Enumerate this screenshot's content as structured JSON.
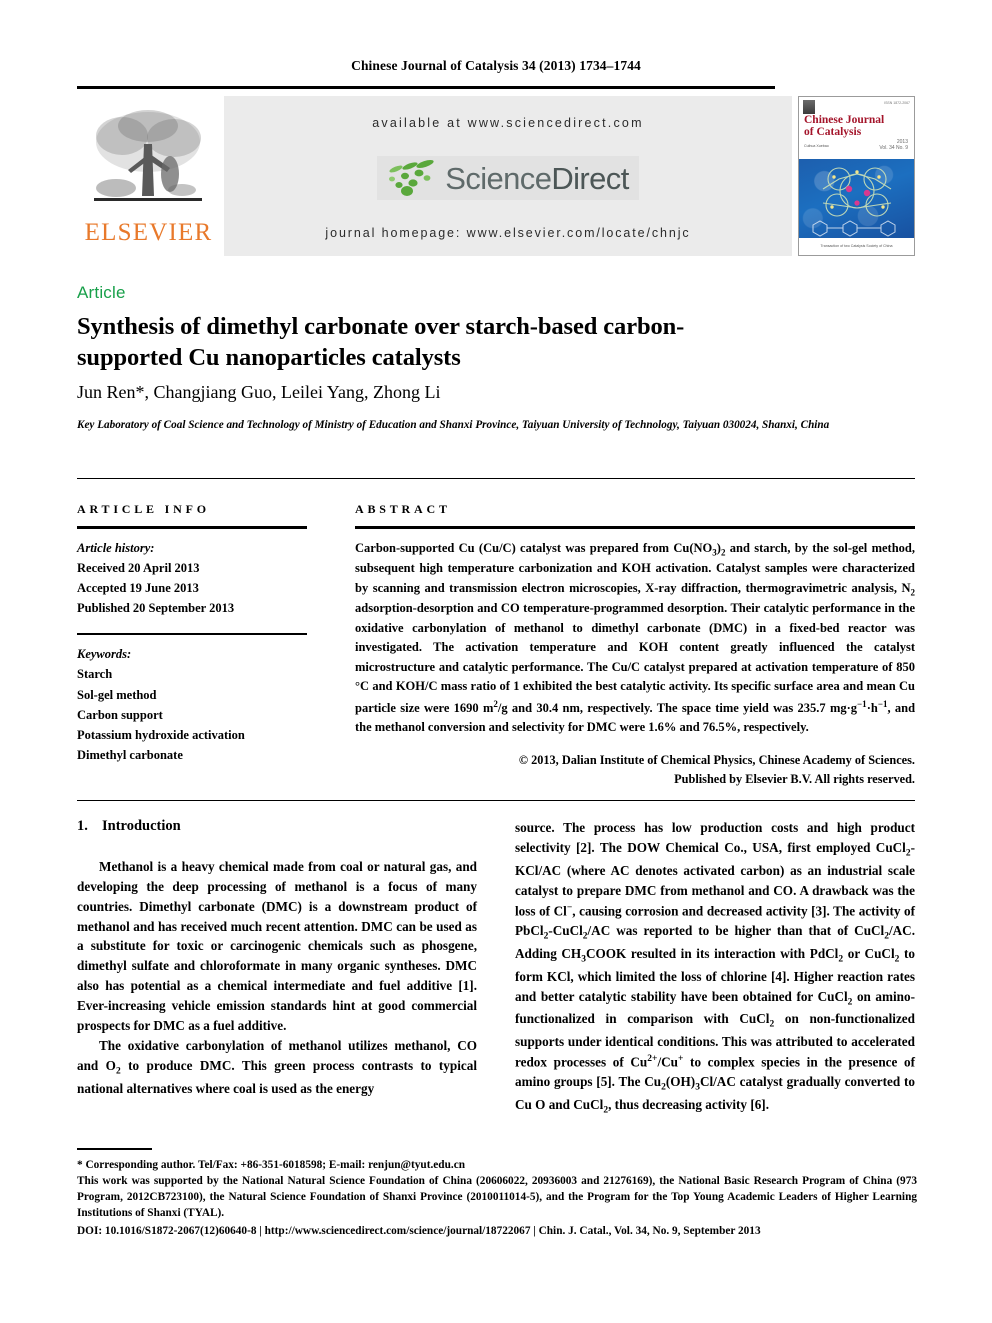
{
  "running_head": "Chinese Journal of Catalysis 34 (2013) 1734–1744",
  "masthead": {
    "publisher": "ELSEVIER",
    "available_at": "available at www.sciencedirect.com",
    "sciencedirect_word_science": "Science",
    "sciencedirect_word_direct": "Direct",
    "journal_homepage": "journal homepage: www.elsevier.com/locate/chnjc"
  },
  "cover": {
    "issn": "ISSN 1872-2067",
    "title_line1": "Chinese Journal",
    "title_line2": "of Catalysis",
    "subtitle": "Cuihua Xuebao",
    "volume": "2013",
    "issue": "Vol. 34  No. 9",
    "footer": "Transaction of two Catalysis Society of China"
  },
  "article_type": "Article",
  "title": "Synthesis of dimethyl carbonate over starch-based carbon-supported Cu nanoparticles catalysts",
  "authors": "Jun Ren*, Changjiang Guo, Leilei Yang, Zhong Li",
  "affiliation": "Key Laboratory of Coal Science and Technology of Ministry of Education and Shanxi Province, Taiyuan University of Technology, Taiyuan 030024, Shanxi, China",
  "article_info": {
    "heading": "ARTICLE INFO",
    "history_label": "Article history:",
    "history": [
      "Received 20 April 2013",
      "Accepted 19 June 2013",
      "Published 20 September 2013"
    ],
    "keywords_label": "Keywords:",
    "keywords": [
      "Starch",
      "Sol-gel method",
      "Carbon support",
      "Potassium hydroxide activation",
      "Dimethyl carbonate"
    ]
  },
  "abstract": {
    "heading": "ABSTRACT",
    "paragraph_parts": [
      "Carbon-supported Cu (Cu/C) catalyst was prepared from Cu(NO",
      "3",
      ")",
      "2",
      " and starch, by the sol-gel method, subsequent high temperature carbonization and KOH activation. Catalyst samples were characterized by scanning and transmission electron microscopies, X-ray diffraction, thermogravimetric analysis, N",
      "2",
      " adsorption-desorption and CO temperature-programmed desorption. Their catalytic performance in the oxidative carbonylation of methanol to dimethyl carbonate (DMC) in a fixed-bed reactor was investigated. The activation temperature and KOH content greatly influenced the catalyst microstructure and catalytic performance. The Cu/C catalyst prepared at activation temperature of 850 °C and KOH/C mass ratio of 1 exhibited the best catalytic activity. Its specific surface area and mean Cu particle size were 1690 m",
      "2",
      "/g and 30.4 nm, respectively. The space time yield was 235.7 mg·g",
      "−1",
      "·h",
      "−1",
      ", and the methanol conversion and selectivity for DMC were 1.6% and 76.5%, respectively."
    ],
    "copyright_line1": "© 2013, Dalian Institute of Chemical Physics, Chinese Academy of Sciences.",
    "copyright_line2": "Published by Elsevier B.V. All rights reserved."
  },
  "introduction": {
    "number": "1.",
    "heading": "Introduction",
    "left_para1": "Methanol is a heavy chemical made from coal or natural gas, and developing the deep processing of methanol is a focus of many countries. Dimethyl carbonate (DMC) is a downstream product of methanol and has received much recent attention. DMC can be used as a substitute for toxic or carcinogenic chemicals such as phosgene, dimethyl sulfate and chloroformate in many organic syntheses. DMC also has potential as a chemical intermediate and fuel additive [1]. Ever-increasing vehicle emission standards hint at good commercial prospects for DMC as a fuel additive.",
    "left_para2_parts": [
      "The oxidative carbonylation of methanol utilizes methanol, CO and O",
      "2",
      " to produce DMC. This green process contrasts to typical national alternatives where coal is used as the energy"
    ],
    "right_para_parts": [
      "source. The process has low production costs and high product selectivity [2]. The DOW Chemical Co., USA, first employed CuCl",
      "2",
      "-KCl/AC (where AC denotes activated carbon) as an industrial scale catalyst to prepare DMC from methanol and CO. A drawback was the loss of Cl",
      "−",
      ", causing corrosion and decreased activity [3]. The activity of PbCl",
      "2",
      "-CuCl",
      "2",
      "/AC was reported to be higher than that of CuCl",
      "2",
      "/AC. Adding CH",
      "3",
      "COOK resulted in its interaction with PdCl",
      "2",
      " or CuCl",
      "2",
      " to form KCl, which limited the loss of chlorine [4]. Higher reaction rates and better catalytic stability have been obtained for CuCl",
      "2",
      " on amino-functionalized in comparison with CuCl",
      "2",
      " on non-functionalized supports under identical conditions. This was attributed to accelerated redox processes of Cu",
      "2+",
      "/Cu",
      "+",
      " to complex species in the presence of amino groups [5]. The Cu",
      "2",
      "(OH)",
      "3",
      "Cl/AC catalyst gradually converted to Cu O and CuCl",
      "2",
      ", thus decreasing activity [6]."
    ]
  },
  "footnotes": {
    "corresponding": "* Corresponding author. Tel/Fax: +86-351-6018598; E-mail: renjun@tyut.edu.cn",
    "funding": "This work was supported by the National Natural Science Foundation of China (20606022, 20936003 and 21276169), the National Basic Research Program of China (973 Program, 2012CB723100), the Natural Science Foundation of Shanxi Province (2010011014-5), and the Program for the Top Young Academic Leaders of Higher Learning Institutions of Shanxi (TYAL).",
    "doi": "DOI: 10.1016/S1872-2067(12)60640-8 | http://www.sciencedirect.com/science/journal/18722067 | Chin. J. Catal., Vol. 34, No. 9, September 2013"
  },
  "colors": {
    "article_green": "#18A04A",
    "elsevier_orange": "#E8792B",
    "cover_red": "#A4142A",
    "band_gray": "#ebebeb"
  }
}
